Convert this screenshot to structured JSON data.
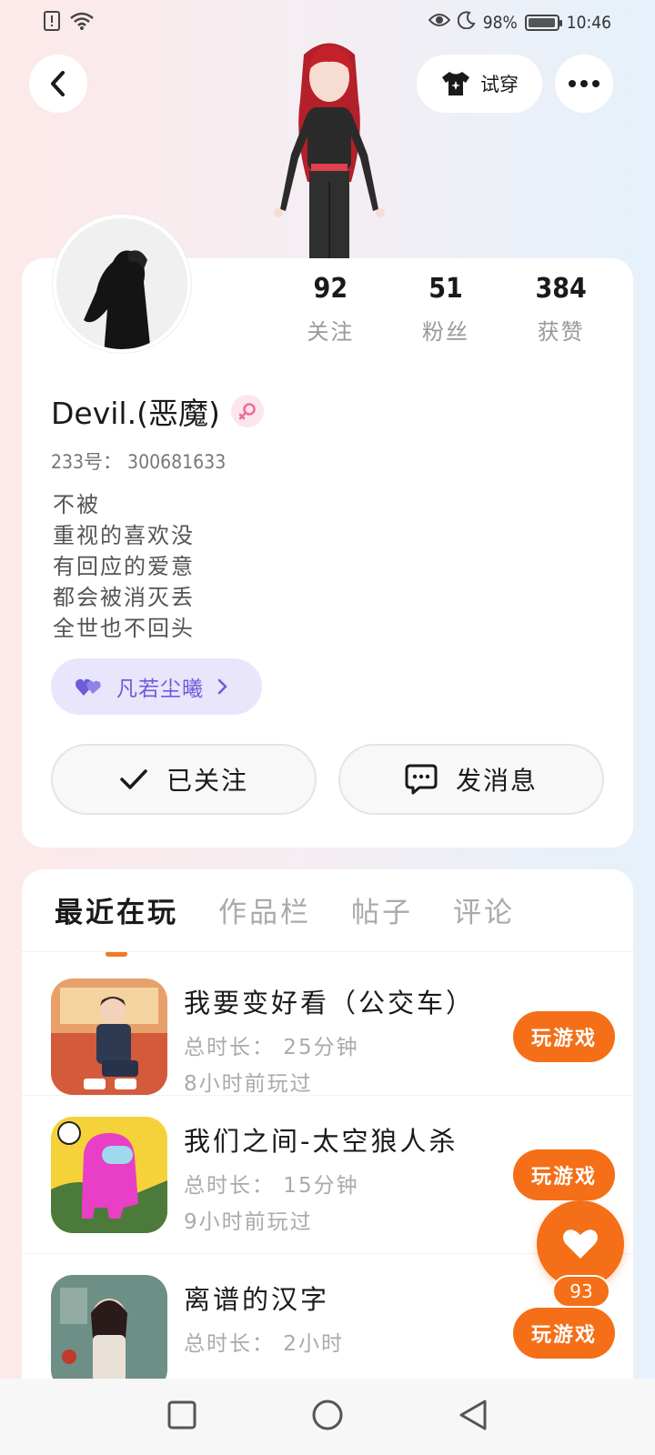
{
  "status_bar": {
    "battery": "98%",
    "time": "10:46",
    "battery_level": 0.98
  },
  "header": {
    "try_on_label": "试穿"
  },
  "profile": {
    "username": "Devil.(恶魔)",
    "uid": "233号：  300681633",
    "bio": [
      "不被",
      "重视的喜欢没",
      "有回应的爱意",
      "都会被消灭丢",
      "全世也不回头"
    ],
    "stats": [
      {
        "value": "92",
        "label": "关注"
      },
      {
        "value": "51",
        "label": "粉丝"
      },
      {
        "value": "384",
        "label": "获赞"
      }
    ],
    "tag": "凡若尘曦",
    "follow_button": "已关注",
    "message_button": "发消息"
  },
  "tabs": [
    "最近在玩",
    "作品栏",
    "帖子",
    "评论"
  ],
  "games": [
    {
      "name": "我要变好看（公交车）",
      "duration": "总时长：  25分钟",
      "last_played": "8小时前玩过",
      "play_label": "玩游戏"
    },
    {
      "name": "我们之间-太空狼人杀",
      "duration": "总时长：  15分钟",
      "last_played": "9小时前玩过",
      "play_label": "玩游戏"
    },
    {
      "name": "离谱的汉字",
      "duration": "总时长：  2小时",
      "last_played": "",
      "play_label": "玩游戏"
    }
  ],
  "like_count": "93",
  "colors": {
    "accent": "#f46f17",
    "tag_bg": "#e9e6fb",
    "tag_text": "#6c5cd9"
  }
}
